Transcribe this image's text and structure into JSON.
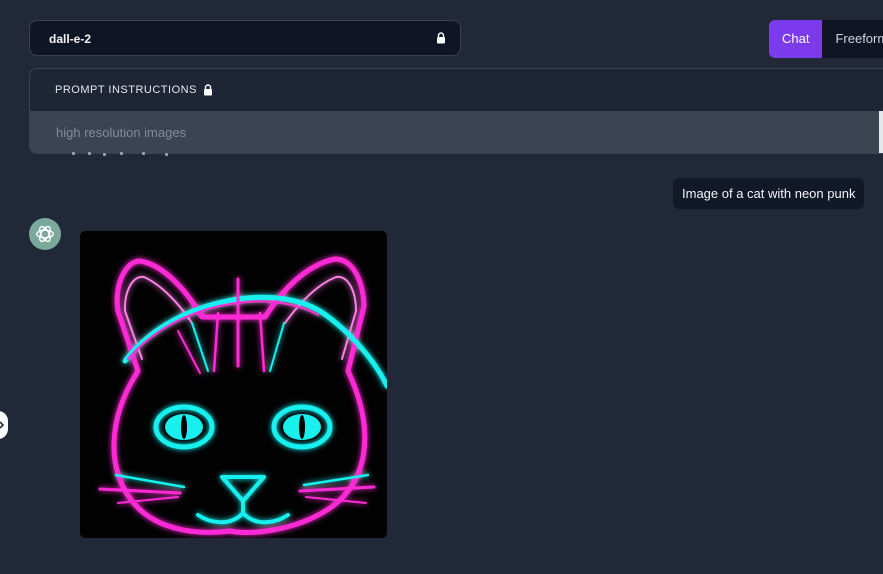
{
  "model_selector": {
    "value": "dall-e-2",
    "icon": "lock-icon"
  },
  "mode_toggle": {
    "options": [
      "Chat",
      "Freeform"
    ],
    "selected": "Chat",
    "accent_color": "#7c3aed"
  },
  "prompt_instructions": {
    "label": "PROMPT INSTRUCTIONS",
    "icon": "lock-icon",
    "placeholder": "high resolution images"
  },
  "conversation": {
    "user_message": "Image of a cat with neon punk",
    "assistant": {
      "avatar_icon": "openai-logo-icon",
      "image_description": "neon punk cat"
    }
  },
  "colors": {
    "background": "#212838",
    "input_background": "#0f1524",
    "neon_pink": "#ff2bd6",
    "neon_cyan": "#18f0ee"
  }
}
